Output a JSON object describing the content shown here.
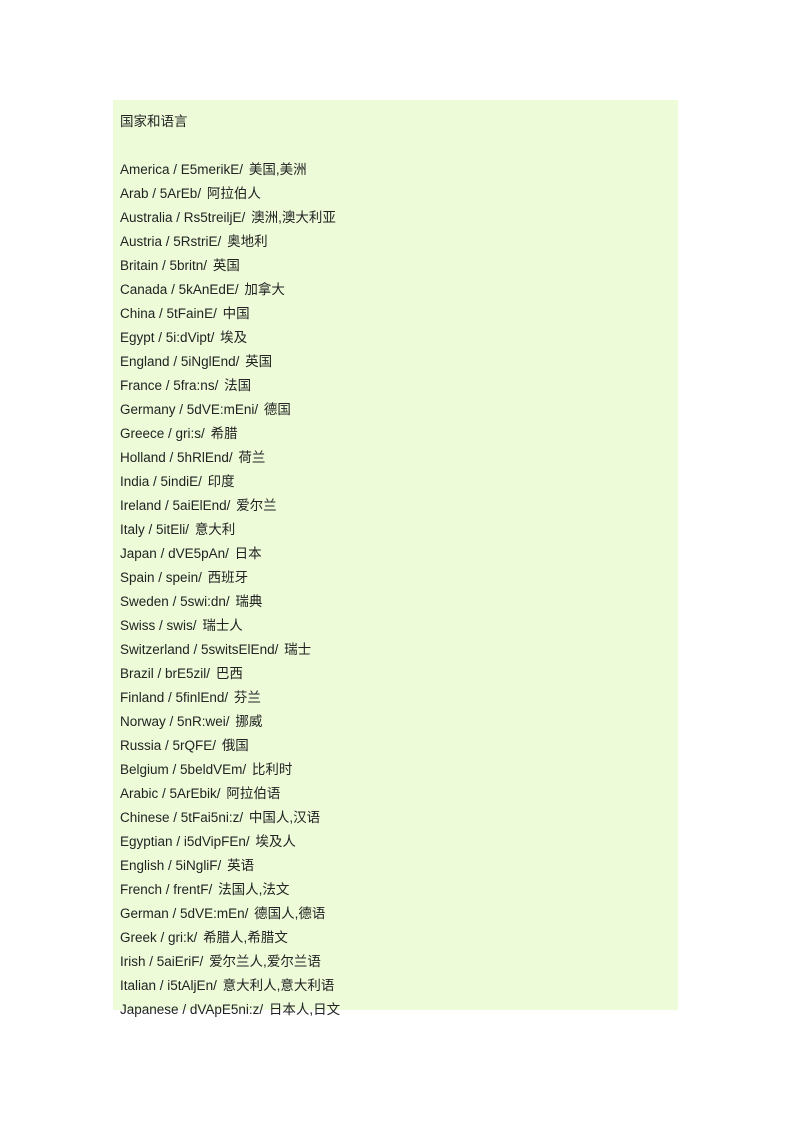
{
  "document": {
    "title": "国家和语言",
    "background_color": "#edfbd9",
    "page_background_color": "#ffffff",
    "text_color": "#222222",
    "separator": "/",
    "entries": [
      {
        "word": "America",
        "phonetic": "/ E5merikE/",
        "gloss": "美国,美洲"
      },
      {
        "word": "Arab",
        "phonetic": "/ 5ArEb/",
        "gloss": "阿拉伯人"
      },
      {
        "word": "Australia",
        "phonetic": "/ Rs5treiljE/",
        "gloss": "澳洲,澳大利亚"
      },
      {
        "word": "Austria",
        "phonetic": "/ 5RstriE/",
        "gloss": "奥地利"
      },
      {
        "word": "Britain",
        "phonetic": "/ 5britn/",
        "gloss": "英国"
      },
      {
        "word": "Canada",
        "phonetic": "/ 5kAnEdE/",
        "gloss": "加拿大"
      },
      {
        "word": "China",
        "phonetic": "/ 5tFainE/",
        "gloss": "中国"
      },
      {
        "word": "Egypt",
        "phonetic": "/ 5i:dVipt/",
        "gloss": "埃及"
      },
      {
        "word": "England",
        "phonetic": "/ 5iNglEnd/",
        "gloss": "英国"
      },
      {
        "word": "France",
        "phonetic": "/ 5fra:ns/",
        "gloss": "法国"
      },
      {
        "word": "Germany",
        "phonetic": "/ 5dVE:mEni/",
        "gloss": "德国"
      },
      {
        "word": "Greece",
        "phonetic": "/ gri:s/",
        "gloss": "希腊"
      },
      {
        "word": "Holland",
        "phonetic": "/ 5hRlEnd/",
        "gloss": "荷兰"
      },
      {
        "word": "India",
        "phonetic": "/ 5indiE/",
        "gloss": "印度"
      },
      {
        "word": "Ireland",
        "phonetic": "/ 5aiElEnd/",
        "gloss": "爱尔兰"
      },
      {
        "word": "Italy",
        "phonetic": "/ 5itEli/",
        "gloss": "意大利"
      },
      {
        "word": "Japan",
        "phonetic": "/ dVE5pAn/",
        "gloss": "日本"
      },
      {
        "word": "Spain",
        "phonetic": "/ spein/",
        "gloss": "西班牙"
      },
      {
        "word": "Sweden",
        "phonetic": "/ 5swi:dn/",
        "gloss": "瑞典"
      },
      {
        "word": "Swiss",
        "phonetic": "/ swis/",
        "gloss": "瑞士人"
      },
      {
        "word": "Switzerland",
        "phonetic": "/ 5switsElEnd/",
        "gloss": "瑞士"
      },
      {
        "word": "Brazil",
        "phonetic": "/ brE5zil/",
        "gloss": "巴西"
      },
      {
        "word": "Finland",
        "phonetic": "/ 5finlEnd/",
        "gloss": "芬兰"
      },
      {
        "word": "Norway",
        "phonetic": "/ 5nR:wei/",
        "gloss": "挪威"
      },
      {
        "word": "Russia",
        "phonetic": "/ 5rQFE/",
        "gloss": "俄国"
      },
      {
        "word": "Belgium",
        "phonetic": "/ 5beldVEm/",
        "gloss": "比利时"
      },
      {
        "word": "Arabic",
        "phonetic": "/ 5ArEbik/",
        "gloss": "阿拉伯语"
      },
      {
        "word": "Chinese",
        "phonetic": "/ 5tFai5ni:z/",
        "gloss": "中国人,汉语"
      },
      {
        "word": "Egyptian",
        "phonetic": "/ i5dVipFEn/",
        "gloss": "埃及人"
      },
      {
        "word": "English",
        "phonetic": "/ 5iNgliF/",
        "gloss": "英语"
      },
      {
        "word": "French",
        "phonetic": "/ frentF/",
        "gloss": "法国人,法文"
      },
      {
        "word": "German",
        "phonetic": "/ 5dVE:mEn/",
        "gloss": "德国人,德语"
      },
      {
        "word": "Greek",
        "phonetic": "/ gri:k/",
        "gloss": "希腊人,希腊文"
      },
      {
        "word": "Irish",
        "phonetic": "/ 5aiEriF/",
        "gloss": "爱尔兰人,爱尔兰语"
      },
      {
        "word": "Italian",
        "phonetic": "/ i5tAljEn/",
        "gloss": "意大利人,意大利语"
      },
      {
        "word": "Japanese",
        "phonetic": "/ dVApE5ni:z/",
        "gloss": "日本人,日文"
      }
    ]
  }
}
